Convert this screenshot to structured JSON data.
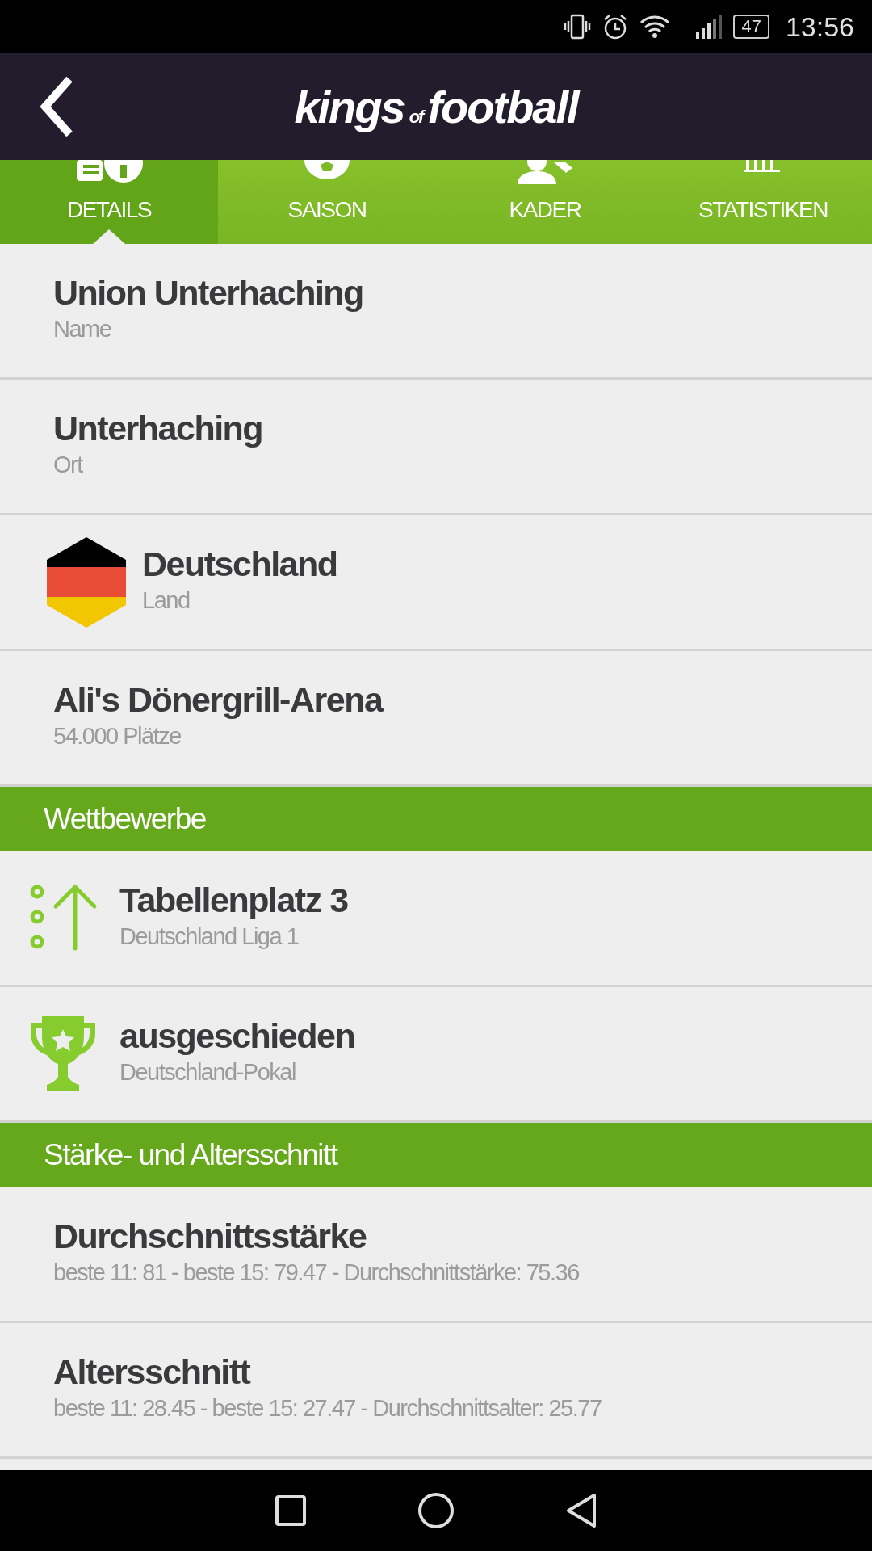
{
  "status_bar": {
    "battery": "47",
    "time": "13:56"
  },
  "header": {
    "logo": {
      "main": "kings",
      "small": "of",
      "second": "football"
    }
  },
  "tabs": [
    {
      "label": "DETAILS",
      "kind": "info",
      "selected": true
    },
    {
      "label": "SAISON",
      "kind": "ball",
      "selected": false
    },
    {
      "label": "KADER",
      "kind": "people",
      "selected": false
    },
    {
      "label": "STATISTIKEN",
      "kind": "chart",
      "selected": false
    }
  ],
  "groups": [
    {
      "items": [
        {
          "kind": "plain",
          "title": "Union Unterhaching",
          "subtitle": "Name"
        },
        {
          "kind": "plain",
          "title": "Unterhaching",
          "subtitle": "Ort"
        },
        {
          "kind": "flag",
          "title": "Deutschland",
          "subtitle": "Land"
        },
        {
          "kind": "plain",
          "title": "Ali's Dönergrill-Arena",
          "subtitle": "54.000 Plätze"
        }
      ]
    },
    {
      "heading": "Wettbewerbe",
      "items": [
        {
          "kind": "ranking",
          "title": "Tabellenplatz 3",
          "subtitle": "Deutschland Liga 1"
        },
        {
          "kind": "trophy",
          "title": "ausgeschieden",
          "subtitle": "Deutschland-Pokal"
        }
      ]
    },
    {
      "heading": "Stärke- und Altersschnitt",
      "items": [
        {
          "kind": "plain",
          "title": "Durchschnittsstärke",
          "subtitle": "beste 11: 81 - beste 15: 79.47 - Durchschnittstärke: 75.36"
        },
        {
          "kind": "plain",
          "title": "Altersschnitt",
          "subtitle": "beste 11: 28.45 - beste 15: 27.47 - Durchschnittsalter: 25.77"
        }
      ]
    }
  ]
}
